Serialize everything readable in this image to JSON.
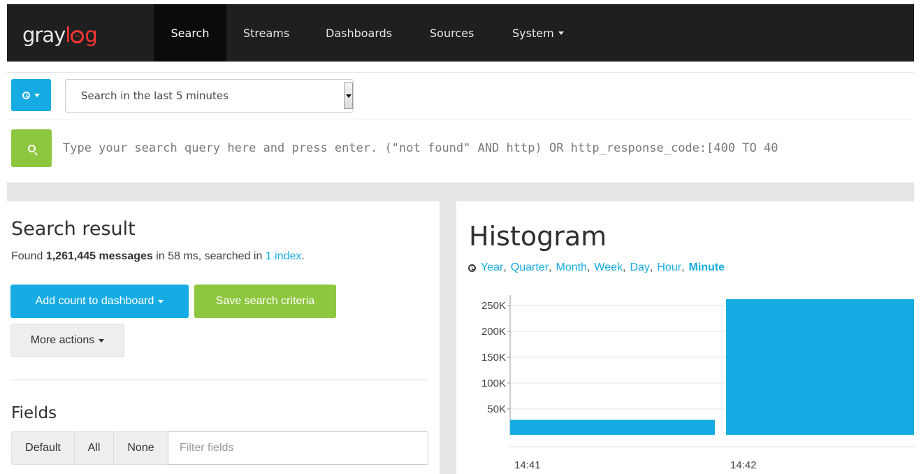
{
  "navbar": {
    "brand": {
      "part1": "gray",
      "part2": "g"
    },
    "items": [
      {
        "label": "Search",
        "active": true
      },
      {
        "label": "Streams"
      },
      {
        "label": "Dashboards"
      },
      {
        "label": "Sources"
      },
      {
        "label": "System",
        "dropdown": true
      }
    ]
  },
  "search_bar": {
    "time_range": "Search in the last 5 minutes",
    "query_placeholder": "Type your search query here and press enter. (\"not found\" AND http) OR http_response_code:[400 TO 40"
  },
  "result": {
    "title": "Search result",
    "found_prefix": "Found",
    "count": "1,261,445 messages",
    "found_mid": "in 58 ms, searched in",
    "index_link": "1 index",
    "found_suffix": ".",
    "add_count_label": "Add count to dashboard",
    "save_label": "Save search criteria",
    "more_actions_label": "More actions"
  },
  "fields": {
    "title": "Fields",
    "default_label": "Default",
    "all_label": "All",
    "none_label": "None",
    "filter_placeholder": "Filter fields"
  },
  "histogram": {
    "title": "Histogram",
    "resolutions": [
      "Year",
      "Quarter",
      "Month",
      "Week",
      "Day",
      "Hour",
      "Minute"
    ],
    "active_resolution": "Minute"
  },
  "colors": {
    "accent": "#16ace3",
    "success": "#8dc63f",
    "nav_bg": "#1f1f1f",
    "brand_red": "#ff3633"
  },
  "chart_data": {
    "type": "bar",
    "categories": [
      "14:41",
      "14:42"
    ],
    "values": [
      29000,
      262000
    ],
    "ylim": [
      0,
      270000
    ],
    "yticks": [
      {
        "value": 50000,
        "label": "50K"
      },
      {
        "value": 100000,
        "label": "100K"
      },
      {
        "value": 150000,
        "label": "150K"
      },
      {
        "value": 200000,
        "label": "200K"
      },
      {
        "value": 250000,
        "label": "250K"
      }
    ],
    "grid": true
  }
}
